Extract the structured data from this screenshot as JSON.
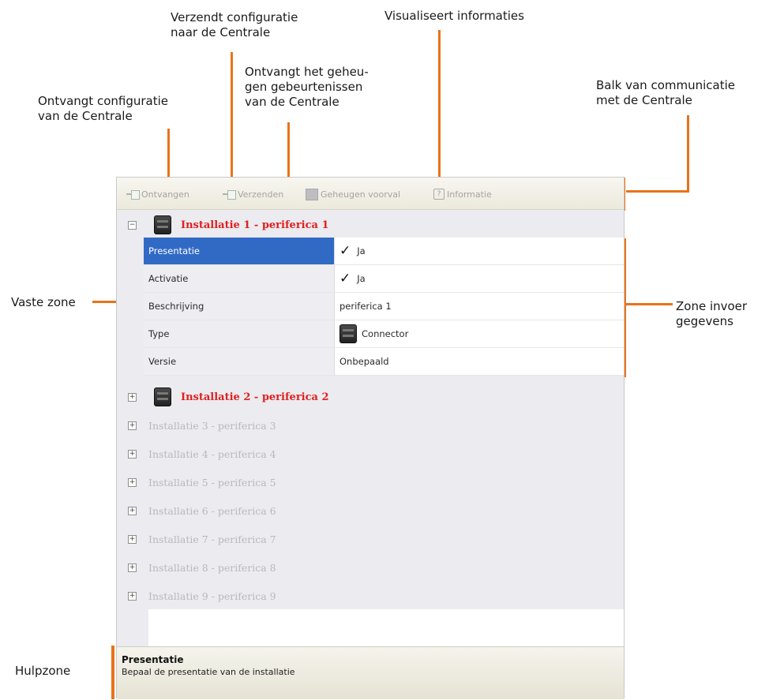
{
  "annotations": {
    "receive_config": [
      "Ontvangt configuratie",
      "van de Centrale"
    ],
    "send_config": [
      "Verzendt configuratie",
      "naar de Centrale"
    ],
    "receive_memory": [
      "Ontvangt het geheu-",
      "gen gebeurtenissen",
      "van de Centrale"
    ],
    "show_info": [
      "Visualiseert informaties"
    ],
    "comm_bar": [
      "Balk van communicatie",
      "met de Centrale"
    ],
    "fixed_zone": "Vaste zone",
    "data_zone": [
      "Zone invoer",
      "gegevens"
    ],
    "help_zone": "Hulpzone"
  },
  "toolbar": {
    "receive": "Ontvangen",
    "send": "Verzenden",
    "memory": "Geheugen voorval",
    "info": "Informatie"
  },
  "installations": [
    {
      "label": "Installatie 1 - periferica  1",
      "expanded": true
    },
    {
      "label": "Installatie 2 - periferica  2",
      "expanded": false
    },
    {
      "label": "Installatie 3 - periferica  3",
      "expanded": false
    },
    {
      "label": "Installatie 4 - periferica  4",
      "expanded": false
    },
    {
      "label": "Installatie 5 - periferica  5",
      "expanded": false
    },
    {
      "label": "Installatie 6 - periferica  6",
      "expanded": false
    },
    {
      "label": "Installatie 7 - periferica  7",
      "expanded": false
    },
    {
      "label": "Installatie 8 - periferica  8",
      "expanded": false
    },
    {
      "label": "Installatie 9 - periferica  9",
      "expanded": false
    }
  ],
  "properties": [
    {
      "name": "Presentatie",
      "value": "Ja",
      "checked": true
    },
    {
      "name": "Activatie",
      "value": "Ja",
      "checked": true
    },
    {
      "name": "Beschrijving",
      "value": "periferica  1"
    },
    {
      "name": "Type",
      "value": "Connector"
    },
    {
      "name": "Versie",
      "value": "Onbepaald"
    }
  ],
  "help": {
    "title": "Presentatie",
    "text": "Bepaal de presentatie van de installatie"
  },
  "colors": {
    "accent": "#e8731a",
    "selected": "#316ac5",
    "installation_red": "#e02020"
  },
  "icons": {
    "expanded": "minus-box-icon",
    "collapsed": "plus-box-icon",
    "device": "device-panel-icon",
    "check": "check-icon"
  }
}
